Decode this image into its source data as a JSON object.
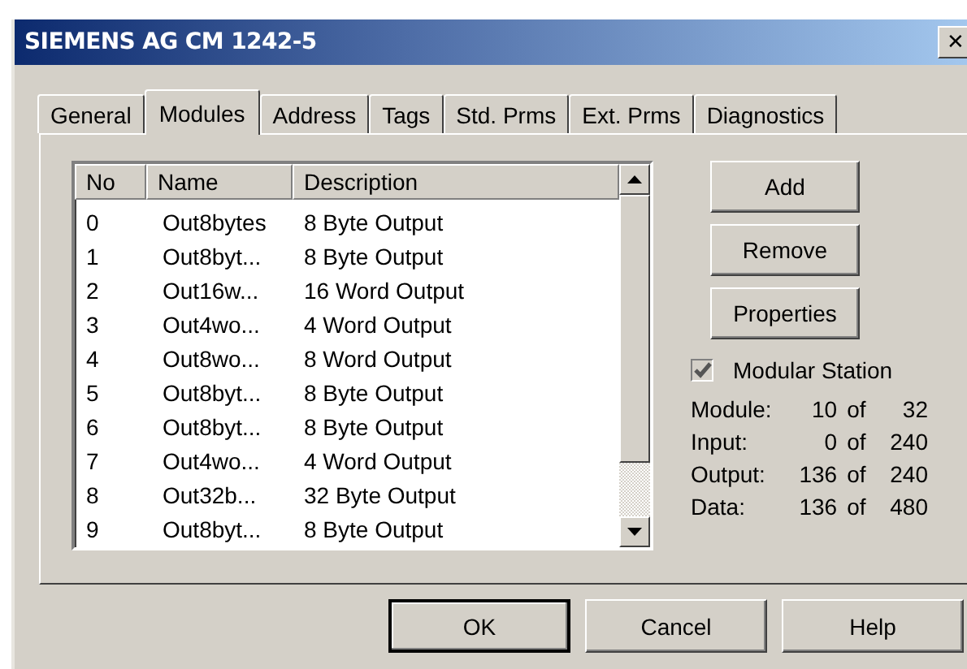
{
  "window": {
    "title": "SIEMENS AG CM 1242-5",
    "close": "✕"
  },
  "tabs": [
    {
      "label": "General",
      "selected": false
    },
    {
      "label": "Modules",
      "selected": true
    },
    {
      "label": "Address",
      "selected": false
    },
    {
      "label": "Tags",
      "selected": false
    },
    {
      "label": "Std. Prms",
      "selected": false
    },
    {
      "label": "Ext. Prms",
      "selected": false
    },
    {
      "label": "Diagnostics",
      "selected": false
    }
  ],
  "table": {
    "columns": [
      "No",
      "Name",
      "Description"
    ],
    "rows": [
      {
        "no": "0",
        "name": "Out8bytes",
        "description": "8 Byte Output"
      },
      {
        "no": "1",
        "name": "Out8byt...",
        "description": "8 Byte Output"
      },
      {
        "no": "2",
        "name": "Out16w...",
        "description": "16 Word Output"
      },
      {
        "no": "3",
        "name": "Out4wo...",
        "description": "4 Word Output"
      },
      {
        "no": "4",
        "name": "Out8wo...",
        "description": "8 Word Output"
      },
      {
        "no": "5",
        "name": "Out8byt...",
        "description": "8 Byte Output"
      },
      {
        "no": "6",
        "name": "Out8byt...",
        "description": "8 Byte Output"
      },
      {
        "no": "7",
        "name": "Out4wo...",
        "description": "4 Word Output"
      },
      {
        "no": "8",
        "name": "Out32b...",
        "description": "32 Byte Output"
      },
      {
        "no": "9",
        "name": "Out8byt...",
        "description": "8 Byte Output"
      }
    ]
  },
  "side_buttons": [
    "Add",
    "Remove",
    "Properties"
  ],
  "modular_station": {
    "label": "Modular Station",
    "checked": true,
    "disabled": true
  },
  "stats": [
    {
      "label": "Module:",
      "value": "10",
      "of": "of",
      "total": "32"
    },
    {
      "label": "Input:",
      "value": "0",
      "of": "of",
      "total": "240"
    },
    {
      "label": "Output:",
      "value": "136",
      "of": "of",
      "total": "240"
    },
    {
      "label": "Data:",
      "value": "136",
      "of": "of",
      "total": "480"
    }
  ],
  "dialog_buttons": [
    {
      "label": "OK",
      "default": true
    },
    {
      "label": "Cancel",
      "default": false
    },
    {
      "label": "Help",
      "default": false
    }
  ]
}
